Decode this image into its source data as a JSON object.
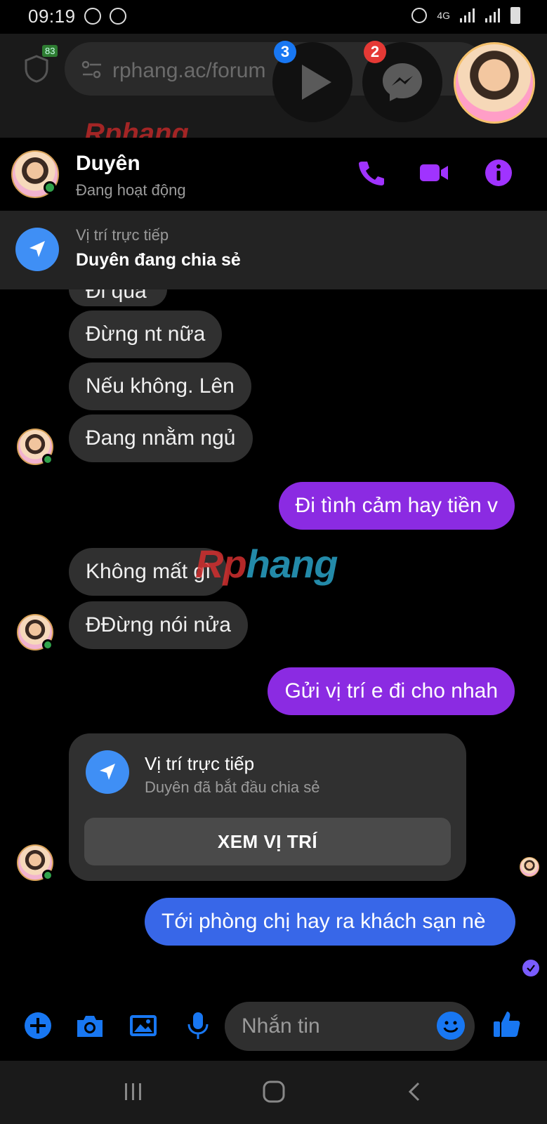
{
  "status_bar": {
    "time": "09:19",
    "network": "4G"
  },
  "browser": {
    "url": "rphang.ac/forum",
    "shield_count": "83",
    "brand": "Rphang"
  },
  "chat_heads": {
    "play_badge": "3",
    "messenger_badge": "2"
  },
  "header": {
    "name": "Duyên",
    "status": "Đang hoạt động",
    "icons": [
      "phone-icon",
      "video-icon",
      "info-icon"
    ],
    "accent": "#a033ff"
  },
  "live_location_banner": {
    "label": "Vị trí trực tiếp",
    "title": "Duyên đang chia sẻ"
  },
  "messages": [
    {
      "from": "them",
      "text": "Đi quá"
    },
    {
      "from": "them",
      "text": "Đừng  nt nữa"
    },
    {
      "from": "them",
      "text": "Nếu  không. Lên"
    },
    {
      "from": "them",
      "text": "Đang nnằm ngủ"
    },
    {
      "from": "me",
      "text": "Đi tình cảm hay tiền v"
    },
    {
      "from": "them",
      "text": "Không mất  gì"
    },
    {
      "from": "them",
      "text": "ĐĐừng nói  nửa"
    },
    {
      "from": "me",
      "text": "Gửi vị trí e đi cho nhah"
    },
    {
      "from": "me",
      "text": "Tới phòng chị hay ra khách sạn nè"
    }
  ],
  "location_card": {
    "title": "Vị trí trực tiếp",
    "subtitle": "Duyên đã bắt đầu chia sẻ",
    "button": "XEM VỊ TRÍ"
  },
  "watermark": {
    "red": "Rp",
    "blue": "hang"
  },
  "composer": {
    "placeholder": "Nhắn tin",
    "icons": [
      "plus-icon",
      "camera-icon",
      "gallery-icon",
      "mic-icon",
      "emoji-icon",
      "like-icon"
    ],
    "icon_color": "#1877f2"
  },
  "colors": {
    "incoming_bubble": "#303030",
    "outgoing_purple": "#8b2be2",
    "outgoing_blue": "#3867e8",
    "online": "#31a24c"
  }
}
